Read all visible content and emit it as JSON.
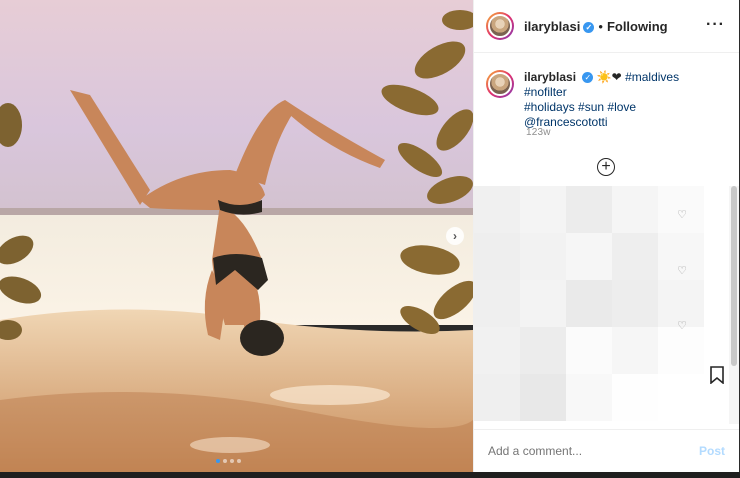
{
  "post": {
    "username": "ilaryblasi",
    "verified_icon": "verified-badge-icon",
    "follow_state": "Following",
    "menu_icon": "more-options-icon",
    "caption": {
      "emoji": "☀️❤",
      "hashtags_line1": "#maldives #nofilter",
      "hashtags_line2": "#holidays #sun #love",
      "mention": "@francescototti"
    },
    "timestamp": "123w",
    "load_more_icon": "plus-circle-icon",
    "carousel": {
      "slide_count": 4,
      "active_index": 0,
      "next_icon": "chevron-right-icon"
    }
  },
  "comment_box": {
    "placeholder": "Add a comment...",
    "post_label": "Post"
  },
  "colors": {
    "link": "#003569",
    "verified": "#3897f0",
    "post_disabled": "#b3dbff",
    "muted": "#8e8e8e"
  }
}
